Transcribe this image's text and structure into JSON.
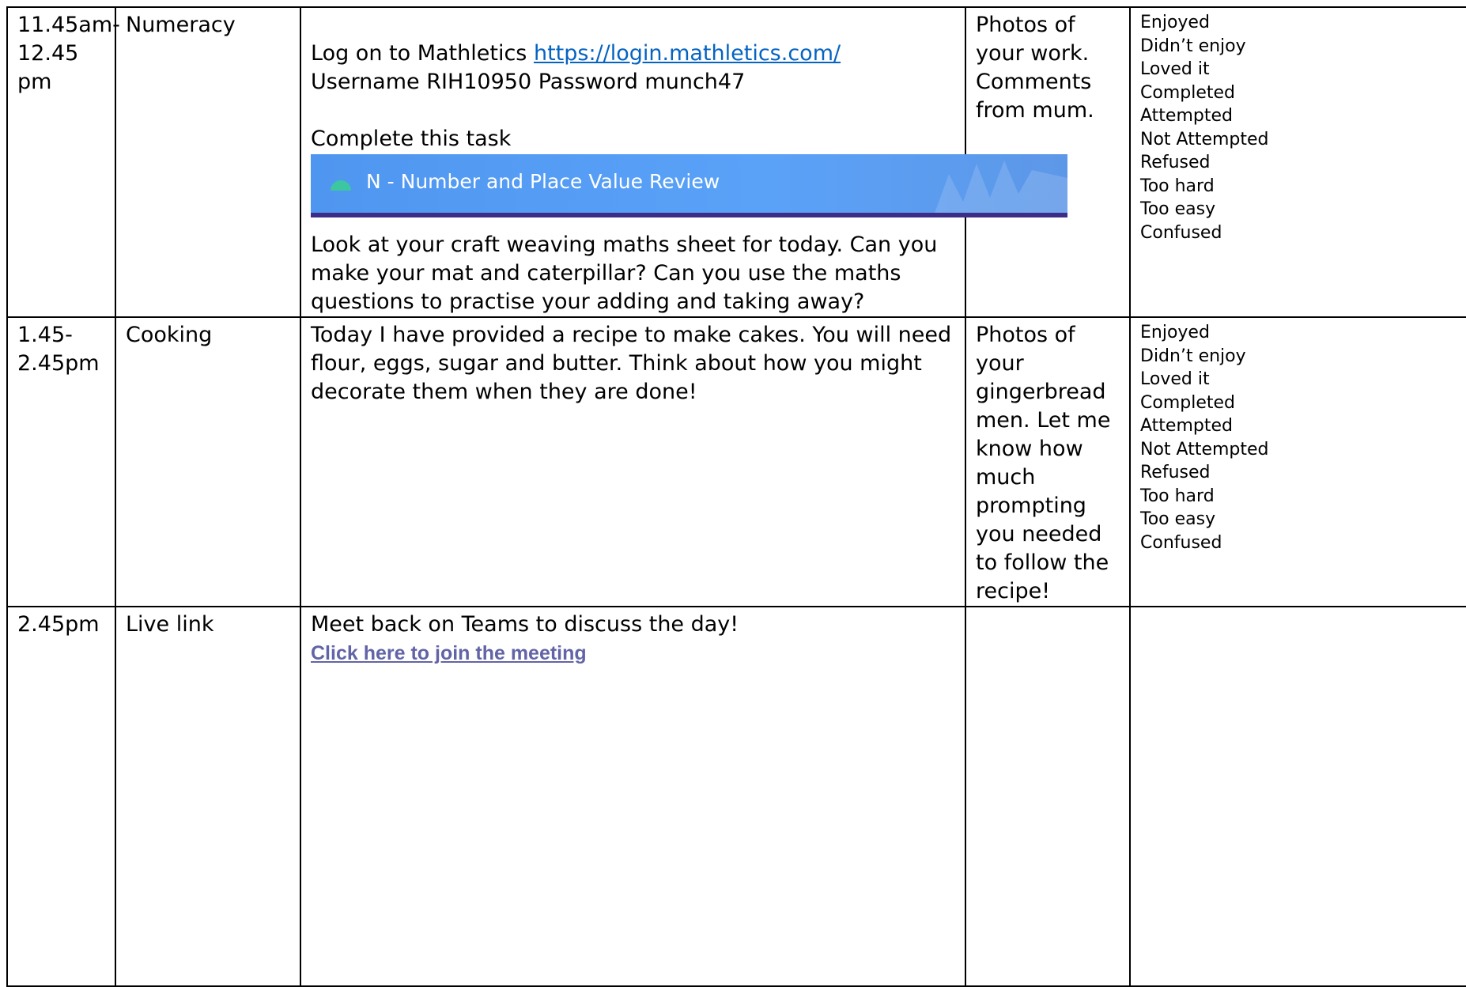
{
  "rows": [
    {
      "time": "11.45am-12.45 pm",
      "subject": "Numeracy",
      "activity": {
        "login_prefix": "Log on to Mathletics ",
        "login_link": "https://login.mathletics.com/",
        "credentials": "Username RIH10950  Password munch47",
        "task_heading": "Complete this task",
        "task_banner": "N - Number and Place Value Review",
        "instructions": "Look at your craft weaving maths sheet for today. Can you make your mat and caterpillar? Can you use the maths questions to practise your adding and taking away?"
      },
      "evidence": "Photos of your work. Comments from mum.",
      "feedback": [
        "Enjoyed",
        "Didn’t enjoy",
        "Loved it",
        "Completed",
        "Attempted",
        "Not Attempted",
        "Refused",
        "Too hard",
        "Too easy",
        "Confused"
      ]
    },
    {
      "time": "1.45-2.45pm",
      "subject": "Cooking",
      "activity": {
        "text": "Today I have provided a recipe to make cakes. You will need flour, eggs, sugar and butter. Think about how you might decorate them when they are done!"
      },
      "evidence": "Photos of your gingerbread men. Let me know how much prompting you needed to follow the recipe!",
      "feedback": [
        "Enjoyed",
        "Didn’t enjoy",
        "Loved it",
        "Completed",
        "Attempted",
        "Not Attempted",
        "Refused",
        "Too hard",
        "Too easy",
        "Confused"
      ]
    },
    {
      "time": "2.45pm",
      "subject": "Live link",
      "activity": {
        "text": "Meet back on Teams to discuss the day!",
        "link": "Click here to join the meeting"
      },
      "evidence": "",
      "feedback": []
    }
  ],
  "colors": {
    "link": "#0563C1",
    "teams_link": "#6264A7",
    "banner": "#5aa2f8",
    "banner_underline": "#3c2e86",
    "banner_icon": "#3cc7a0"
  },
  "icons": {
    "banner_icon": "mathletics-strand-icon"
  }
}
